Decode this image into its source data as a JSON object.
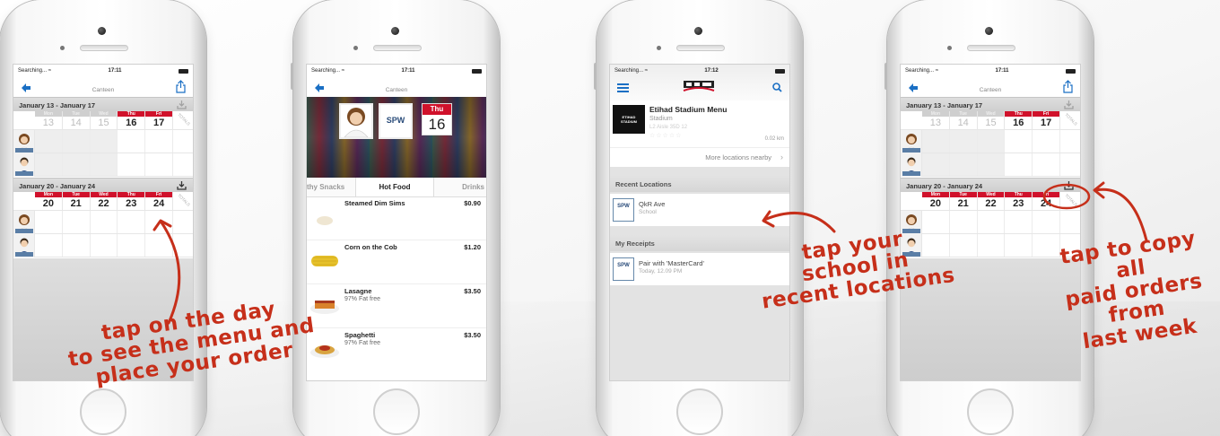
{
  "phone1": {
    "status": {
      "carrier": "Searching...",
      "time": "17:11"
    },
    "nav_title": "Canteen",
    "week1": {
      "range": "January 13 - January 17",
      "days": [
        {
          "name": "Mon",
          "num": "13",
          "enabled": false
        },
        {
          "name": "Tue",
          "num": "14",
          "enabled": false
        },
        {
          "name": "Wed",
          "num": "15",
          "enabled": false
        },
        {
          "name": "Thu",
          "num": "16",
          "enabled": true
        },
        {
          "name": "Fri",
          "num": "17",
          "enabled": true
        }
      ]
    },
    "week2": {
      "range": "January 20 - January 24",
      "days": [
        {
          "name": "Mon",
          "num": "20",
          "enabled": true
        },
        {
          "name": "Tue",
          "num": "21",
          "enabled": true
        },
        {
          "name": "Wed",
          "num": "22",
          "enabled": true
        },
        {
          "name": "Thu",
          "num": "23",
          "enabled": true
        },
        {
          "name": "Fri",
          "num": "24",
          "enabled": true
        }
      ]
    },
    "totals_label": "TOTALS",
    "annotation": [
      "tap on the day",
      "to see the menu and",
      "place your order"
    ]
  },
  "phone2": {
    "status": {
      "carrier": "Searching...",
      "time": "17:11"
    },
    "nav_title": "Canteen",
    "date_month": "Thu",
    "date_day": "16",
    "school_logo": "SPW",
    "tabs": [
      "thy Snacks",
      "Hot Food",
      "Drinks"
    ],
    "items": [
      {
        "name": "Steamed Dim Sims",
        "sub": "",
        "price": "$0.90"
      },
      {
        "name": "Corn on the Cob",
        "sub": "",
        "price": "$1.20"
      },
      {
        "name": "Lasagne",
        "sub": "97% Fat free",
        "price": "$3.50"
      },
      {
        "name": "Spaghetti",
        "sub": "97% Fat free",
        "price": "$3.50"
      }
    ]
  },
  "phone3": {
    "status": {
      "carrier": "Searching...",
      "time": "17:12"
    },
    "venue": {
      "title": "Etihad Stadium Menu",
      "sub": "Stadium",
      "addr": "L2 Aisle 35D 12",
      "dist": "0.02 km",
      "logo_line1": "ETIHAD",
      "logo_line2": "STADIUM"
    },
    "more": "More locations nearby",
    "recent_header": "Recent Locations",
    "recent": {
      "title": "QkR Ave",
      "sub": "School"
    },
    "receipts_header": "My Receipts",
    "receipt": {
      "title": "Pair with 'MasterCard'",
      "sub": "Today, 12.09 PM"
    },
    "spw_label": "SPW",
    "annotation": [
      "tap your",
      "school in",
      "recent locations"
    ]
  },
  "phone4": {
    "status": {
      "carrier": "Searching...",
      "time": "17:11"
    },
    "nav_title": "Canteen",
    "week1": {
      "range": "January 13 - January 17",
      "days": [
        {
          "name": "Mon",
          "num": "13",
          "enabled": false
        },
        {
          "name": "Tue",
          "num": "14",
          "enabled": false
        },
        {
          "name": "Wed",
          "num": "15",
          "enabled": false
        },
        {
          "name": "Thu",
          "num": "16",
          "enabled": true
        },
        {
          "name": "Fri",
          "num": "17",
          "enabled": true
        }
      ]
    },
    "week2": {
      "range": "January 20 - January 24",
      "days": [
        {
          "name": "Mon",
          "num": "20",
          "enabled": true
        },
        {
          "name": "Tue",
          "num": "21",
          "enabled": true
        },
        {
          "name": "Wed",
          "num": "22",
          "enabled": true
        },
        {
          "name": "Thu",
          "num": "23",
          "enabled": true
        },
        {
          "name": "Fri",
          "num": "24",
          "enabled": true
        }
      ]
    },
    "totals_label": "TOTALS",
    "annotation": [
      "tap to copy all",
      "paid orders",
      "from",
      "last week"
    ]
  },
  "colors": {
    "accent": "#d0112b",
    "nav_blue": "#1a6fc4",
    "annotation": "#c62f1a"
  },
  "icons": [
    "back-arrow-icon",
    "share-icon",
    "download-icon",
    "hamburger-icon",
    "search-icon",
    "chevron-right-icon"
  ]
}
